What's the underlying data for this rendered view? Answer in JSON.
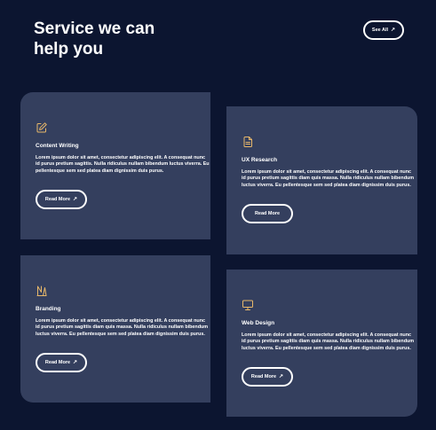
{
  "header": {
    "title": "Service we can\nhelp you",
    "see_all_label": "See All"
  },
  "colors": {
    "background": "#0c1530",
    "card": "#343f5e",
    "icon_accent": "#e8b86a",
    "text": "#ffffff"
  },
  "cards": [
    {
      "icon": "edit-icon",
      "title": "Content Writing",
      "text": "Lorem ipsum dolor sit amet, consectetur adipiscing elit. A consequat nunc id purus pretium sagittis. Nulla ridiculus nullam bibendum luctus viverra. Eu pellentesque sem sed platea diam dignissim duis purus.",
      "button": "Read More"
    },
    {
      "icon": "document-icon",
      "title": "UX Research",
      "text": "Lorem ipsum dolor sit amet, consectetur adipiscing elit. A consequat nunc id purus pretium sagittis diam quis massa. Nulla ridiculus nullam bibendum luctus viverra. Eu pellentesque sem sed platea diam dignissim duis purus.",
      "button": "Read More"
    },
    {
      "icon": "branding-icon",
      "title": "Branding",
      "text": "Lorem ipsum dolor sit amet, consectetur adipiscing elit. A consequat nunc id purus pretium sagittis diam quis massa. Nulla ridiculus nullam bibendum luctus viverra. Eu pellentesque sem sed platea diam dignissim duis purus.",
      "button": "Read More"
    },
    {
      "icon": "monitor-icon",
      "title": "Web Design",
      "text": "Lorem ipsum dolor sit amet, consectetur adipiscing elit. A consequat nunc id purus pretium sagittis diam quis massa. Nulla ridiculus nullam bibendum luctus viverra. Eu pellentesque sem sed platea diam dignissim duis purus.",
      "button": "Read More"
    }
  ]
}
